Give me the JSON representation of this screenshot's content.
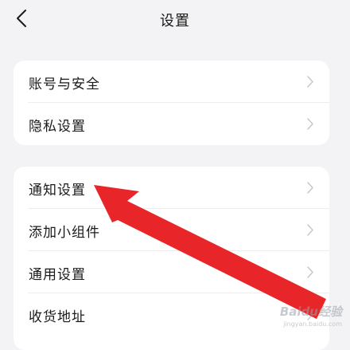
{
  "header": {
    "title": "设置"
  },
  "groups": [
    {
      "items": [
        {
          "label": "账号与安全"
        },
        {
          "label": "隐私设置"
        }
      ]
    },
    {
      "items": [
        {
          "label": "通知设置"
        },
        {
          "label": "添加小组件"
        },
        {
          "label": "通用设置"
        },
        {
          "label": "收货地址"
        }
      ]
    }
  ],
  "annotation": {
    "arrow_color": "#e8262a"
  },
  "watermark": {
    "main": "Baidu经验",
    "sub": "jingyan.baidu.com"
  },
  "colors": {
    "background": "#f3f3f5",
    "card": "#ffffff",
    "chevron": "#c8c8c8"
  },
  "icons": {
    "back": "chevron-left-icon",
    "row_arrow": "chevron-right-icon"
  }
}
